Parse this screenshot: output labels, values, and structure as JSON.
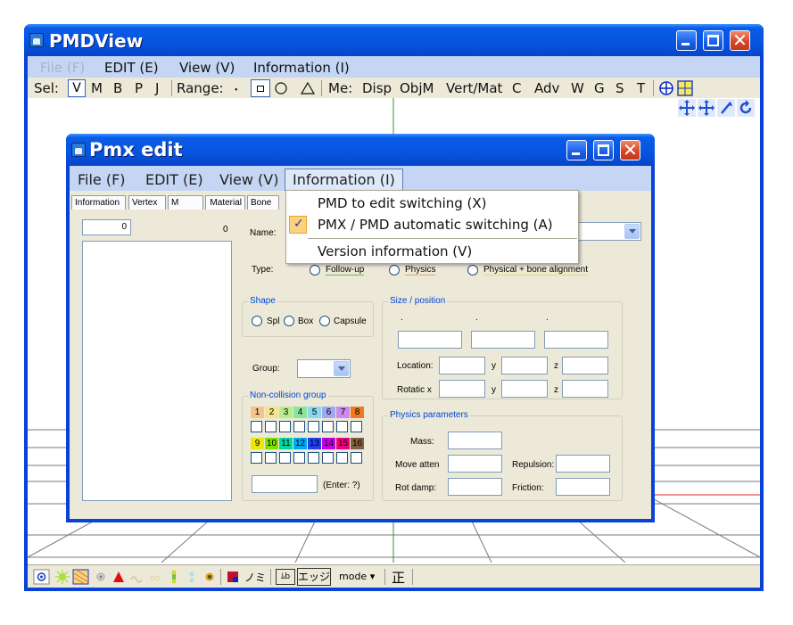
{
  "app": {
    "title": "PMDView"
  },
  "menu": {
    "file": "File (F)",
    "edit": "EDIT (E)",
    "view": "View (V)",
    "info": "Information (I)"
  },
  "toolbar": {
    "sel_label": "Sel:",
    "sel_v": "V",
    "sel_m": "M",
    "sel_b": "B",
    "sel_p": "P",
    "sel_j": "J",
    "range_label": "Range:",
    "range_dot": "･",
    "me_label": "Me:",
    "disp": "Disp",
    "objm": "ObjM",
    "vertmat": "Vert/Mat",
    "c": "C",
    "adv": "Adv",
    "w": "W",
    "g": "G",
    "s": "S",
    "t": "T"
  },
  "dialog": {
    "title": "Pmx edit",
    "menu": {
      "file": "File (F)",
      "edit": "EDIT (E)",
      "view": "View (V)",
      "info": "Information (I)"
    },
    "tabs": [
      "Information",
      "Vertex",
      "M",
      "Material",
      "Bone"
    ],
    "list": {
      "index_value": "0",
      "count": "0"
    },
    "name_label": "Name:",
    "type_label": "Type:",
    "type_options": [
      "Follow-up",
      "Physics",
      "Physical + bone alignment"
    ],
    "shape": {
      "title": "Shape",
      "options": [
        "Spl",
        "Box",
        "Capsule"
      ]
    },
    "size_position": {
      "title": "Size / position",
      "dots": [
        ".",
        ".",
        "."
      ],
      "location": "Location:",
      "rotation": "Rotatic x",
      "y": "y",
      "z": "z"
    },
    "group_label": "Group:",
    "noncollision": {
      "title": "Non-collision group",
      "row1": [
        "1",
        "2",
        "3",
        "4",
        "5",
        "6",
        "7",
        "8"
      ],
      "row2": [
        "9",
        "10",
        "11",
        "12",
        "13",
        "14",
        "15",
        "16"
      ],
      "enter": "(Enter: ?)"
    },
    "physics": {
      "title": "Physics parameters",
      "mass": "Mass:",
      "move": "Move atten",
      "repulsion": "Repulsion:",
      "rot": "Rot damp:",
      "friction": "Friction:"
    }
  },
  "dropdown": {
    "items": [
      "PMD to edit switching (X)",
      "PMX / PMD automatic switching (A)",
      "Version information (V)"
    ],
    "checked_index": 1
  },
  "statusbar": {
    "mode": "mode ▾",
    "sei": "正",
    "edge": "エッジ",
    "mo": "ﾑb",
    "nomi": "ノミ"
  },
  "colors": {
    "titlebar": "#0a5ce8",
    "menubar": "#c4d6f4",
    "panel": "#ece9d8",
    "group_row1": [
      "#f4c48a",
      "#f4e48a",
      "#b8ec8a",
      "#8ae49a",
      "#8ad8ec",
      "#a0a8f4",
      "#c88af0",
      "#f07820"
    ],
    "group_row2": [
      "#e8e800",
      "#80e000",
      "#00d8a0",
      "#00a8f0",
      "#2040f0",
      "#c000e0",
      "#f00080",
      "#806040"
    ]
  }
}
